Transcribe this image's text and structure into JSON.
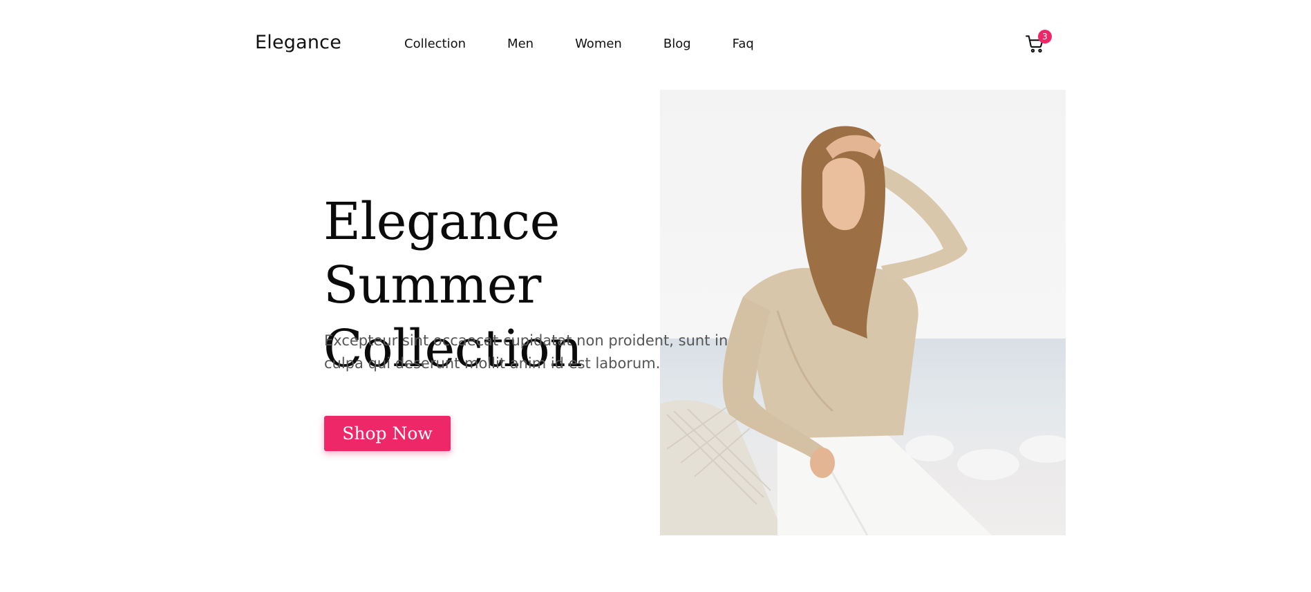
{
  "brand": {
    "name": "Elegance"
  },
  "nav": {
    "items": [
      "Collection",
      "Men",
      "Women",
      "Blog",
      "Faq"
    ]
  },
  "cart": {
    "icon": "cart-icon",
    "count": "3",
    "badge_color": "#ee2769"
  },
  "hero": {
    "title_line1": "Elegance Summer",
    "title_line2": "Collection",
    "text": "Excepteur sint occaecat cupidatat non proident, sunt in culpa qui deserunt mollit anim id est laborum.",
    "button_label": "Shop Now",
    "accent_color": "#ee2769"
  }
}
